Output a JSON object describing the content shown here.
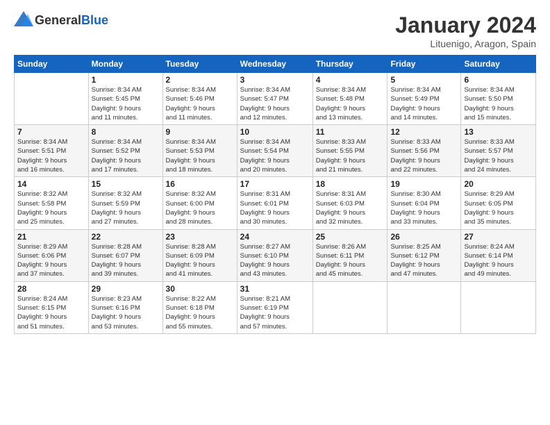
{
  "header": {
    "logo": {
      "general": "General",
      "blue": "Blue"
    },
    "title": "January 2024",
    "location": "Lituenigo, Aragon, Spain"
  },
  "calendar": {
    "weekdays": [
      "Sunday",
      "Monday",
      "Tuesday",
      "Wednesday",
      "Thursday",
      "Friday",
      "Saturday"
    ],
    "weeks": [
      [
        {
          "day": "",
          "info": ""
        },
        {
          "day": "1",
          "info": "Sunrise: 8:34 AM\nSunset: 5:45 PM\nDaylight: 9 hours\nand 11 minutes."
        },
        {
          "day": "2",
          "info": "Sunrise: 8:34 AM\nSunset: 5:46 PM\nDaylight: 9 hours\nand 11 minutes."
        },
        {
          "day": "3",
          "info": "Sunrise: 8:34 AM\nSunset: 5:47 PM\nDaylight: 9 hours\nand 12 minutes."
        },
        {
          "day": "4",
          "info": "Sunrise: 8:34 AM\nSunset: 5:48 PM\nDaylight: 9 hours\nand 13 minutes."
        },
        {
          "day": "5",
          "info": "Sunrise: 8:34 AM\nSunset: 5:49 PM\nDaylight: 9 hours\nand 14 minutes."
        },
        {
          "day": "6",
          "info": "Sunrise: 8:34 AM\nSunset: 5:50 PM\nDaylight: 9 hours\nand 15 minutes."
        }
      ],
      [
        {
          "day": "7",
          "info": "Sunrise: 8:34 AM\nSunset: 5:51 PM\nDaylight: 9 hours\nand 16 minutes."
        },
        {
          "day": "8",
          "info": "Sunrise: 8:34 AM\nSunset: 5:52 PM\nDaylight: 9 hours\nand 17 minutes."
        },
        {
          "day": "9",
          "info": "Sunrise: 8:34 AM\nSunset: 5:53 PM\nDaylight: 9 hours\nand 18 minutes."
        },
        {
          "day": "10",
          "info": "Sunrise: 8:34 AM\nSunset: 5:54 PM\nDaylight: 9 hours\nand 20 minutes."
        },
        {
          "day": "11",
          "info": "Sunrise: 8:33 AM\nSunset: 5:55 PM\nDaylight: 9 hours\nand 21 minutes."
        },
        {
          "day": "12",
          "info": "Sunrise: 8:33 AM\nSunset: 5:56 PM\nDaylight: 9 hours\nand 22 minutes."
        },
        {
          "day": "13",
          "info": "Sunrise: 8:33 AM\nSunset: 5:57 PM\nDaylight: 9 hours\nand 24 minutes."
        }
      ],
      [
        {
          "day": "14",
          "info": "Sunrise: 8:32 AM\nSunset: 5:58 PM\nDaylight: 9 hours\nand 25 minutes."
        },
        {
          "day": "15",
          "info": "Sunrise: 8:32 AM\nSunset: 5:59 PM\nDaylight: 9 hours\nand 27 minutes."
        },
        {
          "day": "16",
          "info": "Sunrise: 8:32 AM\nSunset: 6:00 PM\nDaylight: 9 hours\nand 28 minutes."
        },
        {
          "day": "17",
          "info": "Sunrise: 8:31 AM\nSunset: 6:01 PM\nDaylight: 9 hours\nand 30 minutes."
        },
        {
          "day": "18",
          "info": "Sunrise: 8:31 AM\nSunset: 6:03 PM\nDaylight: 9 hours\nand 32 minutes."
        },
        {
          "day": "19",
          "info": "Sunrise: 8:30 AM\nSunset: 6:04 PM\nDaylight: 9 hours\nand 33 minutes."
        },
        {
          "day": "20",
          "info": "Sunrise: 8:29 AM\nSunset: 6:05 PM\nDaylight: 9 hours\nand 35 minutes."
        }
      ],
      [
        {
          "day": "21",
          "info": "Sunrise: 8:29 AM\nSunset: 6:06 PM\nDaylight: 9 hours\nand 37 minutes."
        },
        {
          "day": "22",
          "info": "Sunrise: 8:28 AM\nSunset: 6:07 PM\nDaylight: 9 hours\nand 39 minutes."
        },
        {
          "day": "23",
          "info": "Sunrise: 8:28 AM\nSunset: 6:09 PM\nDaylight: 9 hours\nand 41 minutes."
        },
        {
          "day": "24",
          "info": "Sunrise: 8:27 AM\nSunset: 6:10 PM\nDaylight: 9 hours\nand 43 minutes."
        },
        {
          "day": "25",
          "info": "Sunrise: 8:26 AM\nSunset: 6:11 PM\nDaylight: 9 hours\nand 45 minutes."
        },
        {
          "day": "26",
          "info": "Sunrise: 8:25 AM\nSunset: 6:12 PM\nDaylight: 9 hours\nand 47 minutes."
        },
        {
          "day": "27",
          "info": "Sunrise: 8:24 AM\nSunset: 6:14 PM\nDaylight: 9 hours\nand 49 minutes."
        }
      ],
      [
        {
          "day": "28",
          "info": "Sunrise: 8:24 AM\nSunset: 6:15 PM\nDaylight: 9 hours\nand 51 minutes."
        },
        {
          "day": "29",
          "info": "Sunrise: 8:23 AM\nSunset: 6:16 PM\nDaylight: 9 hours\nand 53 minutes."
        },
        {
          "day": "30",
          "info": "Sunrise: 8:22 AM\nSunset: 6:18 PM\nDaylight: 9 hours\nand 55 minutes."
        },
        {
          "day": "31",
          "info": "Sunrise: 8:21 AM\nSunset: 6:19 PM\nDaylight: 9 hours\nand 57 minutes."
        },
        {
          "day": "",
          "info": ""
        },
        {
          "day": "",
          "info": ""
        },
        {
          "day": "",
          "info": ""
        }
      ]
    ]
  }
}
